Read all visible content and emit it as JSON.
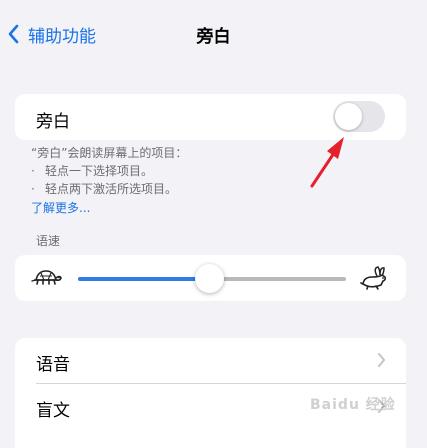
{
  "nav": {
    "back_label": "辅助功能",
    "title": "旁白"
  },
  "voiceover": {
    "label": "旁白",
    "enabled": false
  },
  "description": {
    "heading": "“旁白”会朗读屏幕上的项目：",
    "bullets": [
      "轻点一下选择项目。",
      "轻点两下激活所选项目。"
    ],
    "learn_more": "了解更多..."
  },
  "speech_rate": {
    "label": "语速",
    "value_percent": 49
  },
  "settings_list": {
    "items": [
      {
        "label": "语音"
      },
      {
        "label": "盲文"
      }
    ]
  },
  "annotation": {
    "arrow_color": "#e5202a"
  },
  "watermark": {
    "text": "Baidu 经验"
  },
  "colors": {
    "accent": "#1a73e8",
    "slider_fill": "#2f7ce8",
    "background": "#f2f2f7"
  }
}
